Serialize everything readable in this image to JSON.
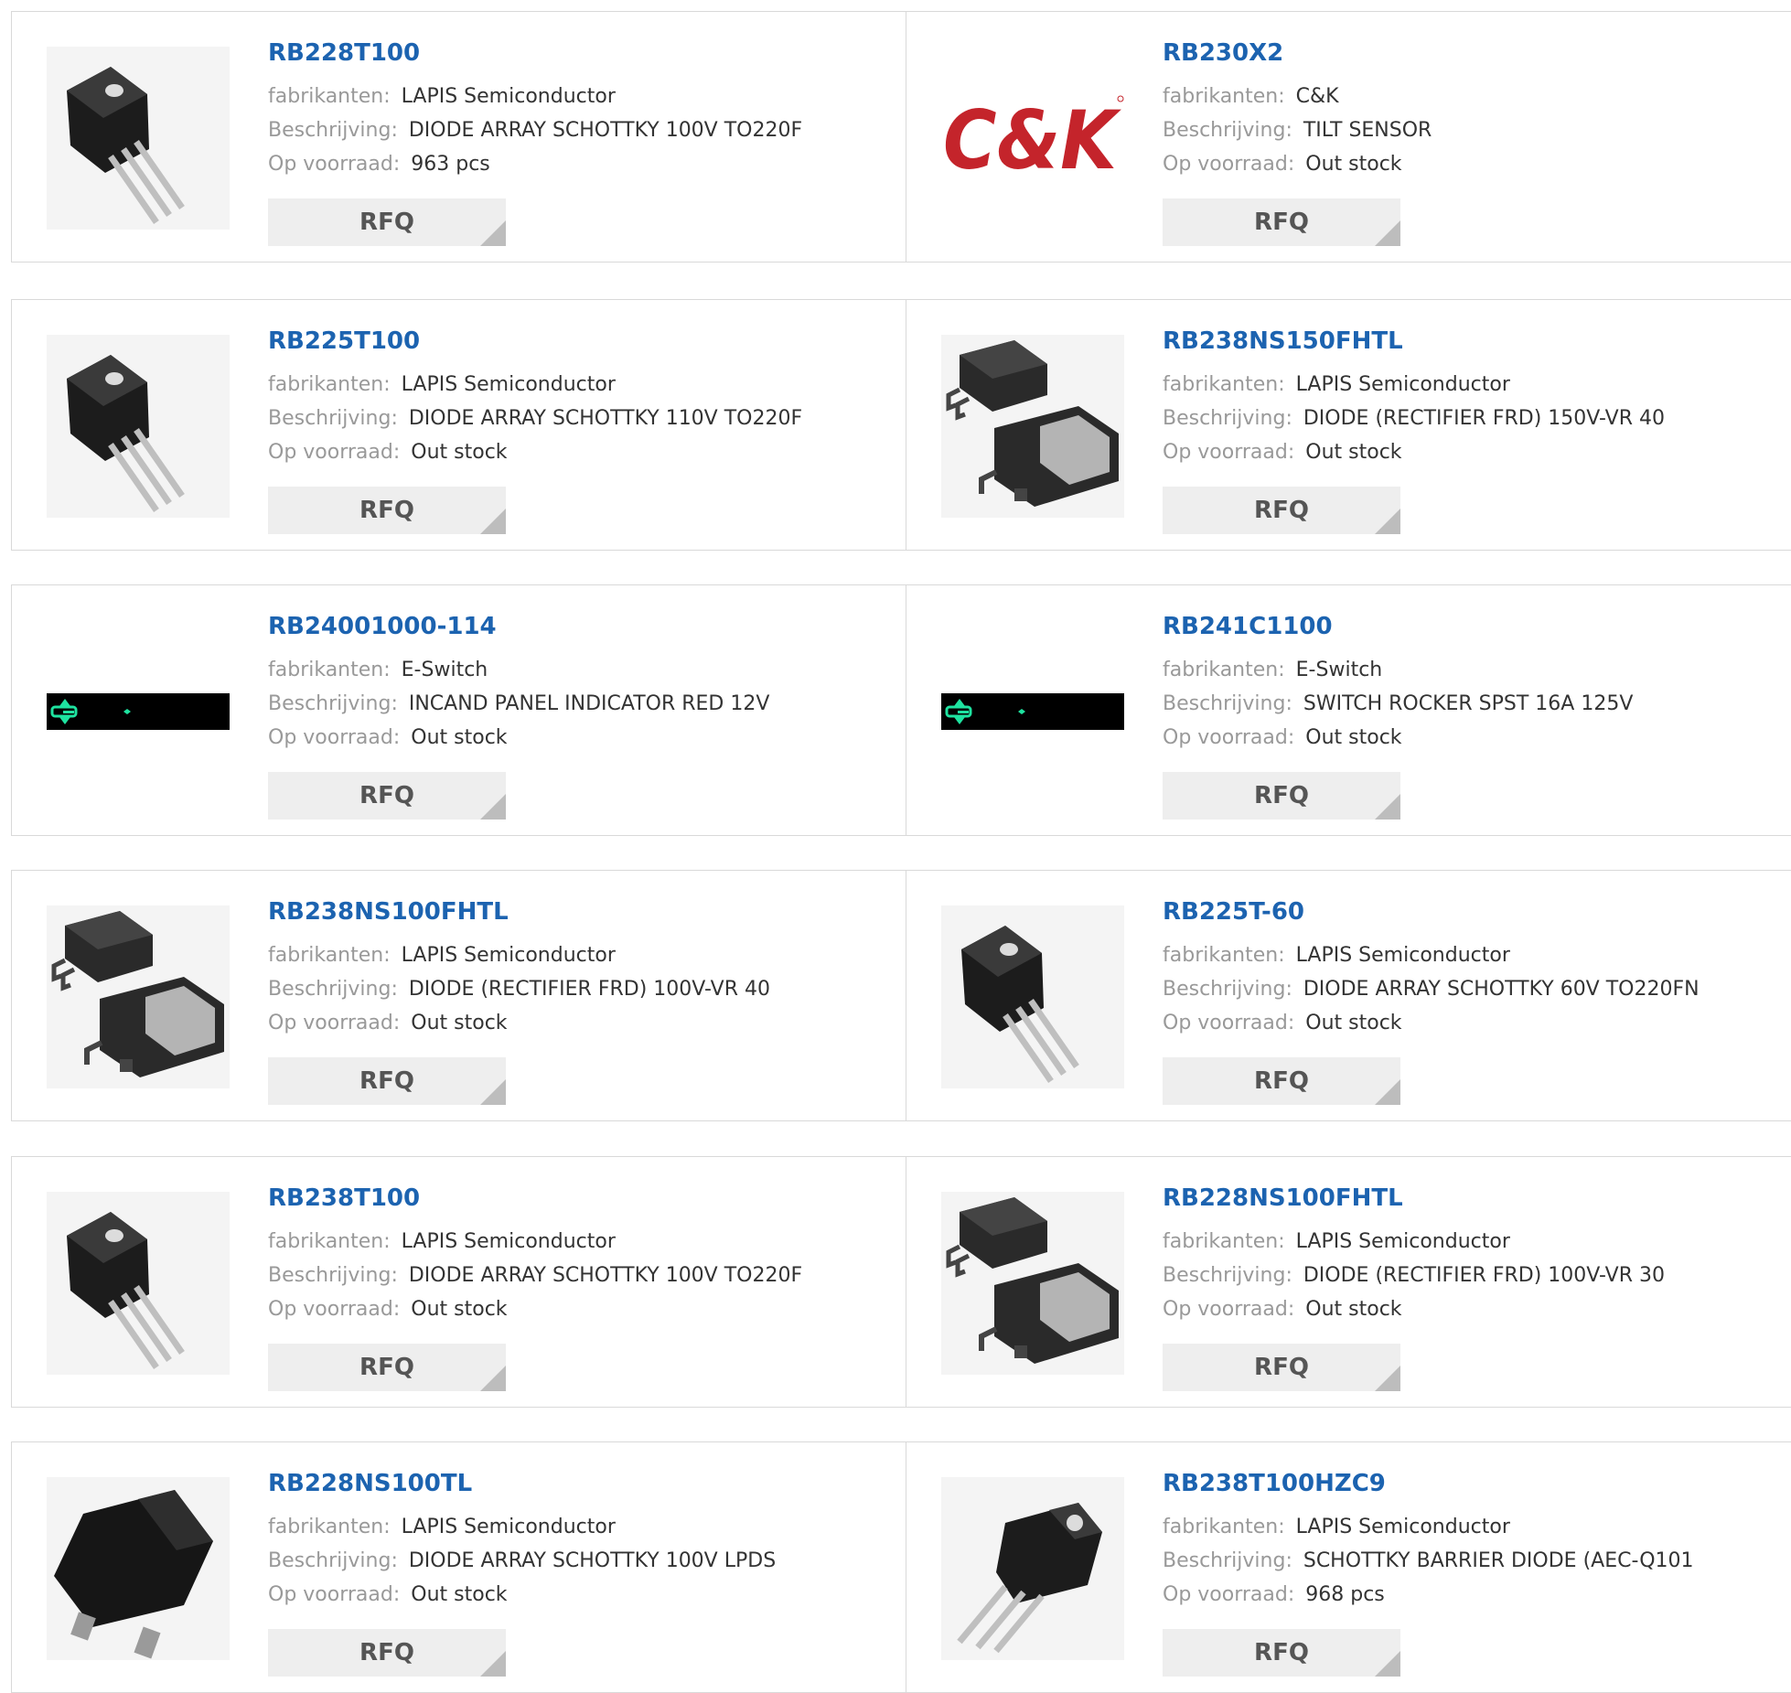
{
  "labels": {
    "manufacturer": "fabrikanten:",
    "description": "Beschrijving:",
    "stock": "Op voorraad:",
    "rfq": "RFQ"
  },
  "products": [
    {
      "part": "RB228T100",
      "manufacturer": "LAPIS Semiconductor",
      "description": "DIODE ARRAY SCHOTTKY 100V TO220F",
      "stock": "963 pcs",
      "image": "to220-package-icon"
    },
    {
      "part": "RB230X2",
      "manufacturer": "C&K",
      "description": "TILT SENSOR",
      "stock": "Out stock",
      "image": "ck-logo"
    },
    {
      "part": "RB225T100",
      "manufacturer": "LAPIS Semiconductor",
      "description": "DIODE ARRAY SCHOTTKY 110V TO220F",
      "stock": "Out stock",
      "image": "to220-package-icon"
    },
    {
      "part": "RB238NS150FHTL",
      "manufacturer": "LAPIS Semiconductor",
      "description": "DIODE (RECTIFIER FRD) 150V-VR 40",
      "stock": "Out stock",
      "image": "dpak-pair-icon"
    },
    {
      "part": "RB24001000-114",
      "manufacturer": "E-Switch",
      "description": "INCAND PANEL INDICATOR RED 12V",
      "stock": "Out stock",
      "image": "eswitch-strip-icon"
    },
    {
      "part": "RB241C1100",
      "manufacturer": "E-Switch",
      "description": "SWITCH ROCKER SPST 16A 125V",
      "stock": "Out stock",
      "image": "eswitch-strip-icon"
    },
    {
      "part": "RB238NS100FHTL",
      "manufacturer": "LAPIS Semiconductor",
      "description": "DIODE (RECTIFIER FRD) 100V-VR 40",
      "stock": "Out stock",
      "image": "dpak-pair-icon"
    },
    {
      "part": "RB225T-60",
      "manufacturer": "LAPIS Semiconductor",
      "description": "DIODE ARRAY SCHOTTKY 60V TO220FN",
      "stock": "Out stock",
      "image": "to220-package-icon"
    },
    {
      "part": "RB238T100",
      "manufacturer": "LAPIS Semiconductor",
      "description": "DIODE ARRAY SCHOTTKY 100V TO220F",
      "stock": "Out stock",
      "image": "to220-package-icon"
    },
    {
      "part": "RB228NS100FHTL",
      "manufacturer": "LAPIS Semiconductor",
      "description": "DIODE (RECTIFIER FRD) 100V-VR 30",
      "stock": "Out stock",
      "image": "dpak-pair-icon"
    },
    {
      "part": "RB228NS100TL",
      "manufacturer": "LAPIS Semiconductor",
      "description": "DIODE ARRAY SCHOTTKY 100V LPDS",
      "stock": "Out stock",
      "image": "lpds-package-icon"
    },
    {
      "part": "RB238T100HZC9",
      "manufacturer": "LAPIS Semiconductor",
      "description": "SCHOTTKY BARRIER DIODE (AEC-Q101",
      "stock": "968 pcs",
      "image": "to220-alt-package-icon"
    }
  ],
  "colors": {
    "link": "#1c63b0",
    "label": "#999999",
    "border": "#d9d9d9",
    "rfq_bg": "#eeeeee",
    "ck_logo": "#c4242b",
    "eswitch_green": "#1ee3a0"
  }
}
